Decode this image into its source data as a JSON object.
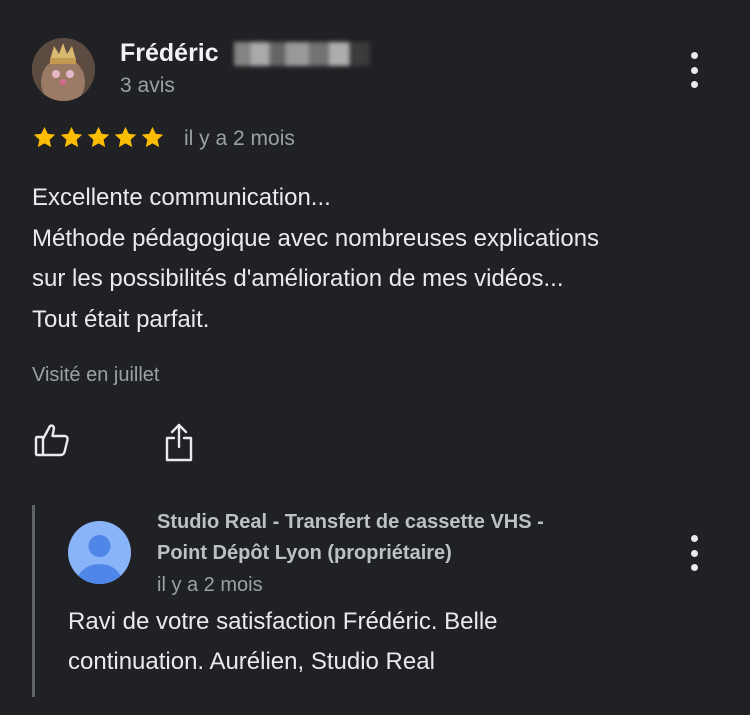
{
  "review": {
    "author": {
      "name": "Frédéric",
      "review_count": "3 avis"
    },
    "rating": {
      "stars": 5,
      "max": 5,
      "star_color": "#fbbc04"
    },
    "date": "il y a 2 mois",
    "text_lines": [
      "Excellente communication...",
      "Méthode pédagogique avec nombreuses explications",
      "sur les possibilités d'amélioration de mes vidéos...",
      "Tout était parfait."
    ],
    "visited": "Visité en juillet",
    "actions": {
      "like_icon": "thumb-up-icon",
      "share_icon": "share-icon"
    },
    "menu_icon": "more-vertical-icon"
  },
  "owner_reply": {
    "name_lines": [
      "Studio Real - Transfert de cassette VHS -",
      "Point Dépôt Lyon (propriétaire)"
    ],
    "date": "il y a 2 mois",
    "text_lines": [
      "Ravi de votre satisfaction Frédéric. Belle",
      "continuation. Aurélien, Studio Real"
    ],
    "avatar_color": "#8ab4f8",
    "menu_icon": "more-vertical-icon"
  },
  "colors": {
    "background": "#202124",
    "text": "#e8eaed",
    "secondary": "#9aa0a6"
  }
}
